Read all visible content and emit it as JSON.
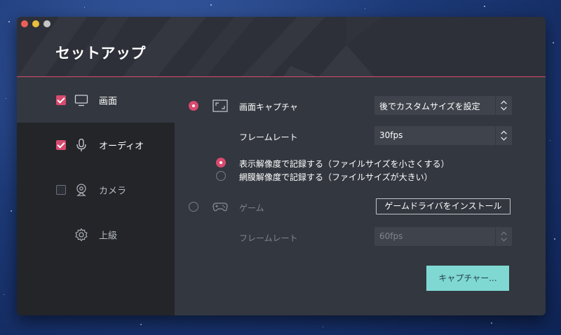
{
  "window": {
    "title": "セットアップ",
    "accent_color": "#d84a6e"
  },
  "sidebar": {
    "items": [
      {
        "label": "画面",
        "icon": "monitor-icon",
        "checked": true
      },
      {
        "label": "オーディオ",
        "icon": "microphone-icon",
        "checked": true
      },
      {
        "label": "カメラ",
        "icon": "webcam-icon",
        "checked": false
      },
      {
        "label": "上級",
        "icon": "gear-icon"
      }
    ]
  },
  "screen_capture": {
    "label": "画面キャプチャ",
    "selected": true,
    "size_select": "後でカスタムサイズを設定",
    "framerate_label": "フレームレート",
    "framerate_select": "30fps",
    "resolution_options": [
      {
        "label": "表示解像度で記録する（ファイルサイズを小さくする）",
        "selected": true
      },
      {
        "label": "網膜解像度で記録する（ファイルサイズが大きい）",
        "selected": false
      }
    ]
  },
  "game_capture": {
    "label": "ゲーム",
    "selected": false,
    "install_button": "ゲームドライバをインストール",
    "framerate_label": "フレームレート",
    "framerate_select": "60fps"
  },
  "footer": {
    "capture_button": "キャプチャー..."
  }
}
